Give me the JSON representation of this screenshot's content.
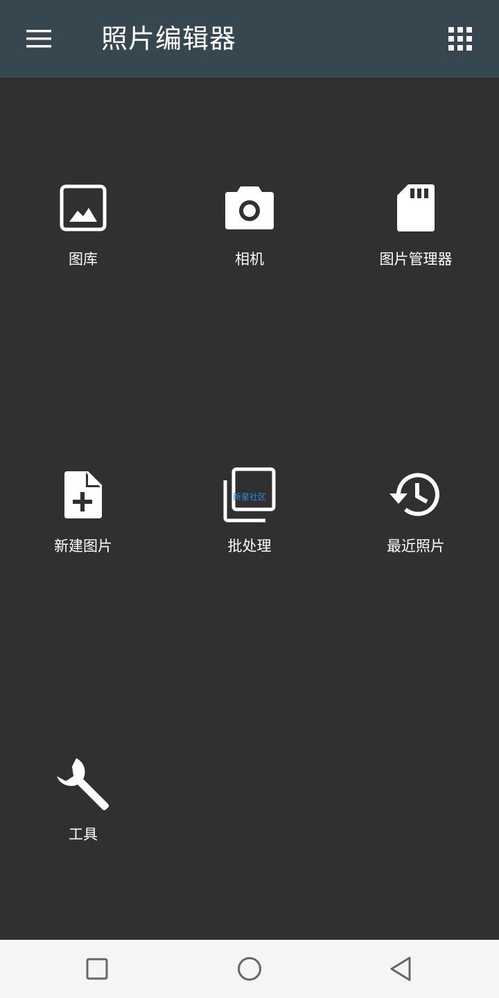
{
  "appbar": {
    "title": "照片编辑器",
    "menu_icon": "menu-icon",
    "grid_icon": "apps-grid-icon",
    "background": "#37474f"
  },
  "tiles": [
    {
      "label": "图库",
      "icon": "image-icon"
    },
    {
      "label": "相机",
      "icon": "camera-icon"
    },
    {
      "label": "图片管理器",
      "icon": "sd-card-icon"
    },
    {
      "label": "新建图片",
      "icon": "new-file-icon"
    },
    {
      "label": "批处理",
      "icon": "batch-icon",
      "overlay_text": "新星社区"
    },
    {
      "label": "最近照片",
      "icon": "history-icon"
    },
    {
      "label": "工具",
      "icon": "wrench-icon"
    }
  ],
  "navbar": {
    "buttons": [
      "recents-icon",
      "home-icon",
      "back-icon"
    ],
    "background": "#f5f5f5"
  },
  "colors": {
    "background": "#303030",
    "icon": "#ffffff",
    "text": "#ffffff",
    "watermark": "#2f8de4"
  }
}
